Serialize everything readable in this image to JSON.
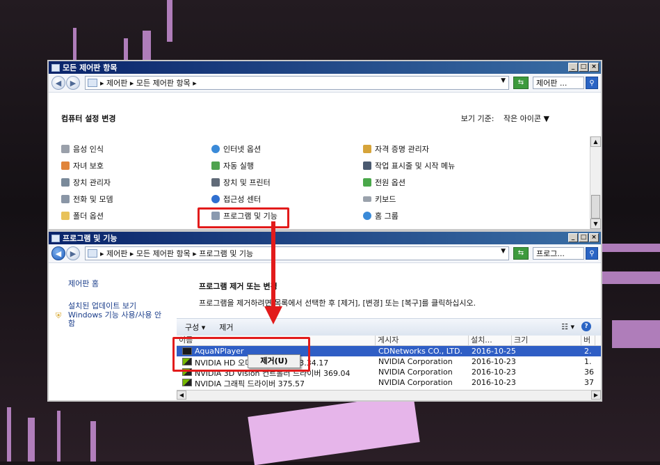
{
  "control_panel": {
    "title": "모든 제어판 항목",
    "breadcrumb": "▸ 제어판 ▸ 모든 제어판 항목 ▸",
    "search_placeholder": "제어판 ...",
    "heading": "컴퓨터 설정 변경",
    "view_by_label": "보기 기준:",
    "view_by_value": "작은 아이콘 ▼",
    "items": [
      {
        "label": "음성 인식",
        "icon": "microphone-icon"
      },
      {
        "label": "인터넷 옵션",
        "icon": "globe-icon"
      },
      {
        "label": "자격 증명 관리자",
        "icon": "vault-icon"
      },
      {
        "label": "자녀 보호",
        "icon": "family-icon"
      },
      {
        "label": "자동 실행",
        "icon": "autoplay-icon"
      },
      {
        "label": "작업 표시줄 및 시작 메뉴",
        "icon": "taskbar-icon"
      },
      {
        "label": "장치 관리자",
        "icon": "device-manager-icon"
      },
      {
        "label": "장치 및 프린터",
        "icon": "printer-icon"
      },
      {
        "label": "전원 옵션",
        "icon": "power-icon"
      },
      {
        "label": "전화 및 모뎀",
        "icon": "phone-icon"
      },
      {
        "label": "접근성 센터",
        "icon": "accessibility-icon"
      },
      {
        "label": "키보드",
        "icon": "keyboard-icon"
      },
      {
        "label": "폴더 옵션",
        "icon": "folder-icon"
      },
      {
        "label": "프로그램 및 기능",
        "icon": "programs-icon"
      },
      {
        "label": "홈 그룹",
        "icon": "homegroup-icon"
      }
    ]
  },
  "programs": {
    "title": "프로그램 및 기능",
    "breadcrumb": "▸ 제어판 ▸ 모든 제어판 항목 ▸ 프로그램 및 기능",
    "search_placeholder": "프로그...",
    "side_links": [
      "제어판 홈",
      "설치된 업데이트 보기",
      "Windows 기능 사용/사용 안 함"
    ],
    "main_title": "프로그램 제거 또는 변경",
    "main_desc": "프로그램을 제거하려면 목록에서 선택한 후 [제거], [변경] 또는 [복구]를 클릭하십시오.",
    "toolbar": {
      "organize": "구성 ▾",
      "uninstall": "제거"
    },
    "columns": [
      "이름",
      "게시자",
      "설치...",
      "크기",
      "버"
    ],
    "rows": [
      {
        "name": "AquaNPlayer",
        "publisher": "CDNetworks CO., LTD.",
        "date": "2016-10-25",
        "size": "",
        "ver": "2."
      },
      {
        "name": "NVIDIA HD 오디오 드라이버 1.3.34.17",
        "publisher": "NVIDIA Corporation",
        "date": "2016-10-23",
        "size": "",
        "ver": "1."
      },
      {
        "name": "NVIDIA 3D Vision 컨트롤러 드라이버 369.04",
        "publisher": "NVIDIA Corporation",
        "date": "2016-10-23",
        "size": "",
        "ver": "36"
      },
      {
        "name": "NVIDIA 그래픽 드라이버 375.57",
        "publisher": "NVIDIA Corporation",
        "date": "2016-10-23",
        "size": "",
        "ver": "37"
      }
    ],
    "context_menu": "제거(U)"
  },
  "colors": {
    "highlight": "#e21b1b",
    "selection": "#2f5ec5",
    "titlebar": "#0a246a"
  }
}
